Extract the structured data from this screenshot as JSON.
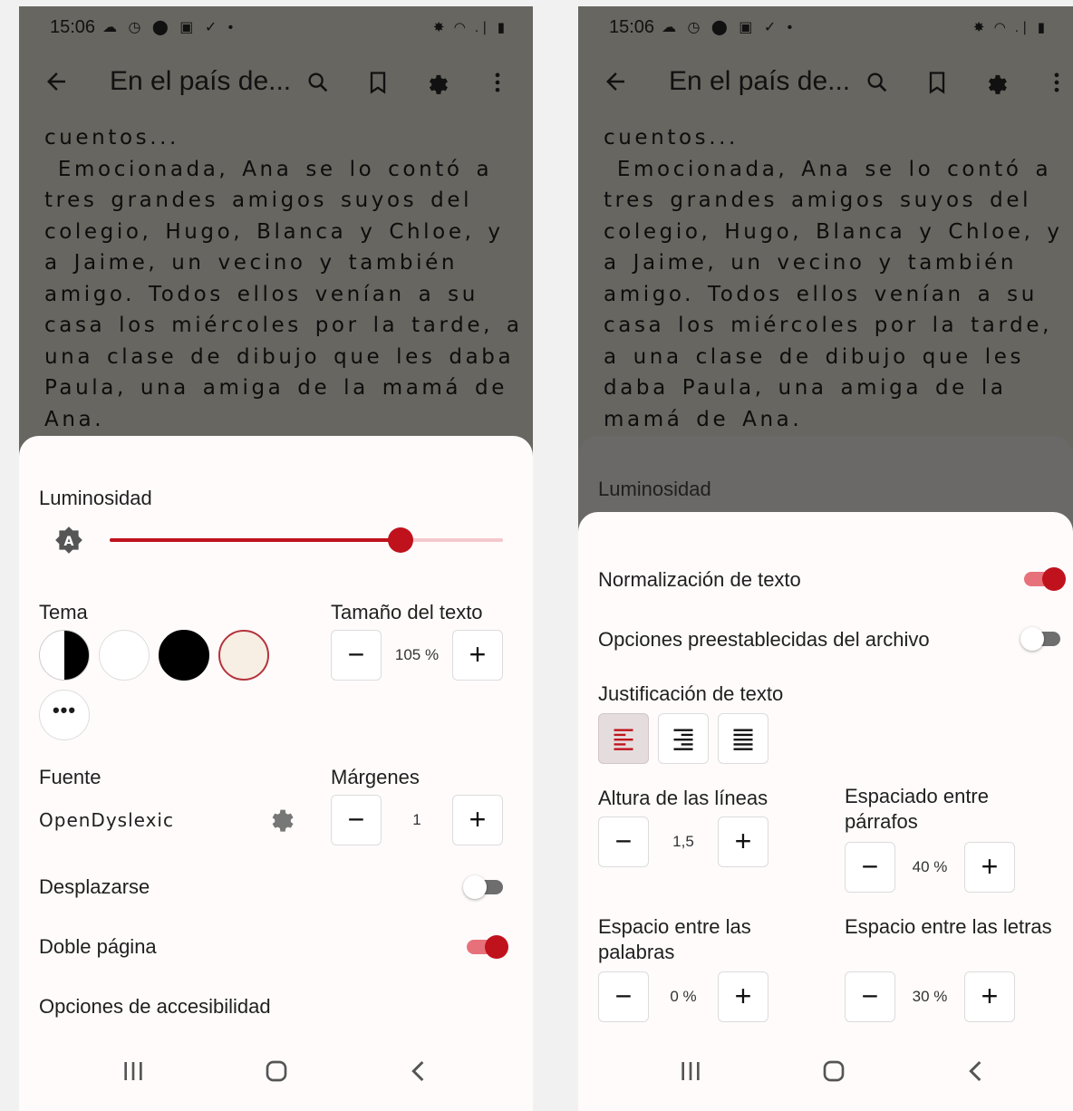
{
  "status_bar": {
    "time": "15:06",
    "left_icons": "☁ ◷ ⬤ ▣ ✓ •",
    "right_icons": "✸ ◠ .∣ ▮"
  },
  "toolbar": {
    "title": "En el país de..."
  },
  "book_text": "cuentos...\n Emocionada, Ana se lo contó a tres grandes amigos suyos del colegio, Hugo, Blanca y Chloe, y a Jaime, un vecino y también amigo. Todos ellos venían a su casa los miércoles por la tarde, a una clase de dibujo que les daba Paula, una amiga de la mamá de Ana.",
  "colors": {
    "accent": "#c0121d",
    "accent_light": "#f4c8cc",
    "reader_bg": "#676660",
    "sheet_bg": "#fffbfb",
    "sepia": "#f8efe4"
  },
  "left_panel": {
    "brightness": {
      "label": "Luminosidad",
      "value": 0.74,
      "icon": "auto-brightness-icon"
    },
    "theme": {
      "label": "Tema",
      "swatches": [
        "auto",
        "white",
        "black",
        "sepia"
      ],
      "selected": "sepia",
      "more": "more-themes-icon"
    },
    "text_size": {
      "label": "Tamaño del texto",
      "value": "105 %"
    },
    "font": {
      "label": "Fuente",
      "value": "OpenDyslexic"
    },
    "margins": {
      "label": "Márgenes",
      "value": "1"
    },
    "scroll": {
      "label": "Desplazarse",
      "on": false
    },
    "double_page": {
      "label": "Doble página",
      "on": true
    },
    "accessibility": {
      "label": "Opciones de accesibilidad"
    }
  },
  "right_panel": {
    "brightness_label": "Luminosidad",
    "text_normalization": {
      "label": "Normalización de texto",
      "on": true
    },
    "publisher_defaults": {
      "label": "Opciones preestablecidas del archivo",
      "on": false
    },
    "justification": {
      "label": "Justificación de texto",
      "options": [
        "align-left",
        "align-right",
        "justify"
      ],
      "selected": "align-left"
    },
    "line_height": {
      "label": "Altura de las líneas",
      "value": "1,5"
    },
    "paragraph_spacing": {
      "label": "Espaciado entre párrafos",
      "value": "40 %"
    },
    "word_spacing": {
      "label": "Espacio entre las palabras",
      "value": "0 %"
    },
    "letter_spacing": {
      "label": "Espacio entre las letras",
      "value": "30 %"
    }
  },
  "stepper": {
    "minus": "−",
    "plus": "+"
  }
}
